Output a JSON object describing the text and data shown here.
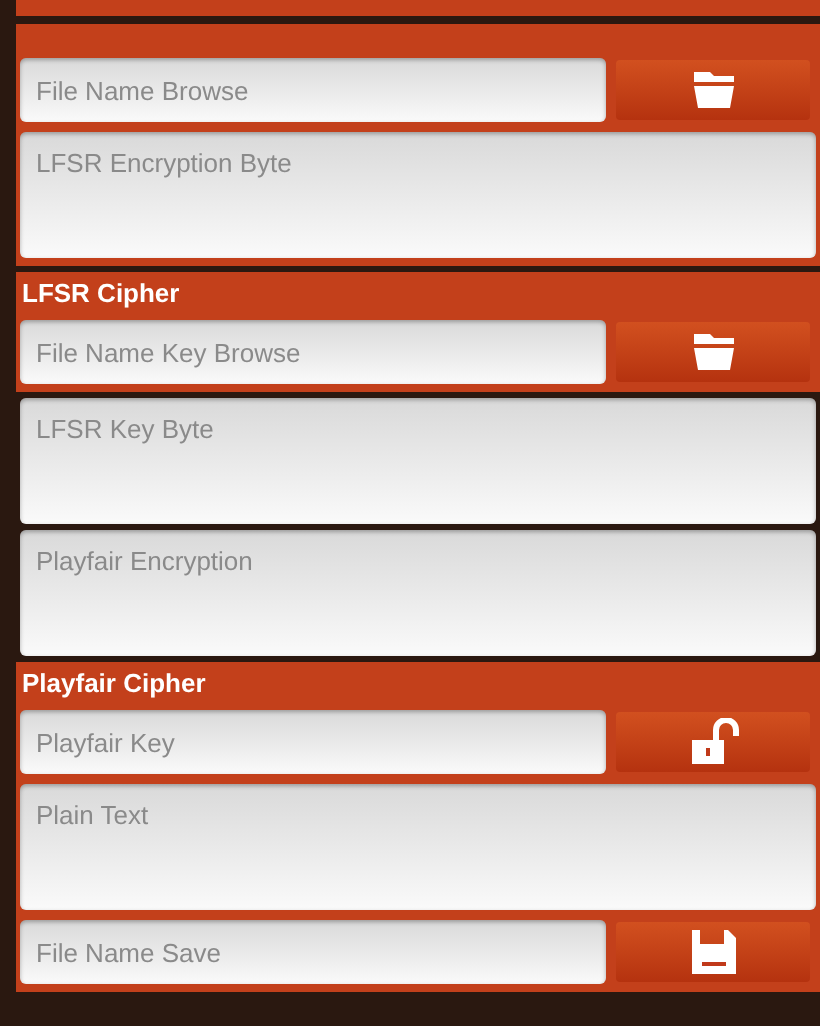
{
  "blocks": [
    {
      "kind": "section",
      "items": [
        {
          "kind": "browse",
          "placeholder": "File Name Browse"
        },
        {
          "kind": "textarea",
          "placeholder": "LFSR Encryption Byte"
        }
      ]
    },
    {
      "kind": "section",
      "title": "LFSR Cipher",
      "items": [
        {
          "kind": "browse",
          "placeholder": "File Name Key Browse"
        }
      ]
    },
    {
      "kind": "plain",
      "items": [
        {
          "kind": "textarea",
          "placeholder": "LFSR Key Byte"
        }
      ]
    },
    {
      "kind": "plain",
      "items": [
        {
          "kind": "textarea",
          "placeholder": "Playfair Encryption"
        }
      ]
    },
    {
      "kind": "section",
      "title": "Playfair Cipher",
      "items": [
        {
          "kind": "key",
          "placeholder": "Playfair Key"
        },
        {
          "kind": "textarea",
          "placeholder": "Plain Text"
        },
        {
          "kind": "save",
          "placeholder": "File Name Save"
        }
      ]
    }
  ]
}
